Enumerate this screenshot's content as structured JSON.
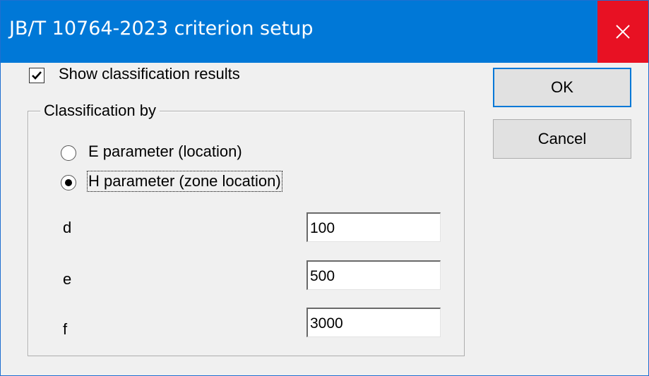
{
  "window": {
    "title": "JB/T 10764-2023 criterion setup",
    "close_icon": "close-icon"
  },
  "options": {
    "show_results_label": "Show classification results",
    "show_results_checked": true
  },
  "classification": {
    "group_label": "Classification by",
    "radios": [
      {
        "label": "E parameter (location)",
        "selected": false
      },
      {
        "label": "H parameter (zone location)",
        "selected": true
      }
    ],
    "params": [
      {
        "label": "d",
        "value": "100"
      },
      {
        "label": "e",
        "value": "500"
      },
      {
        "label": "f",
        "value": "3000"
      }
    ]
  },
  "buttons": {
    "ok_label": "OK",
    "cancel_label": "Cancel"
  },
  "colors": {
    "titlebar": "#0078d7",
    "close_button": "#e81123",
    "dialog_background": "#f0f0f0"
  }
}
